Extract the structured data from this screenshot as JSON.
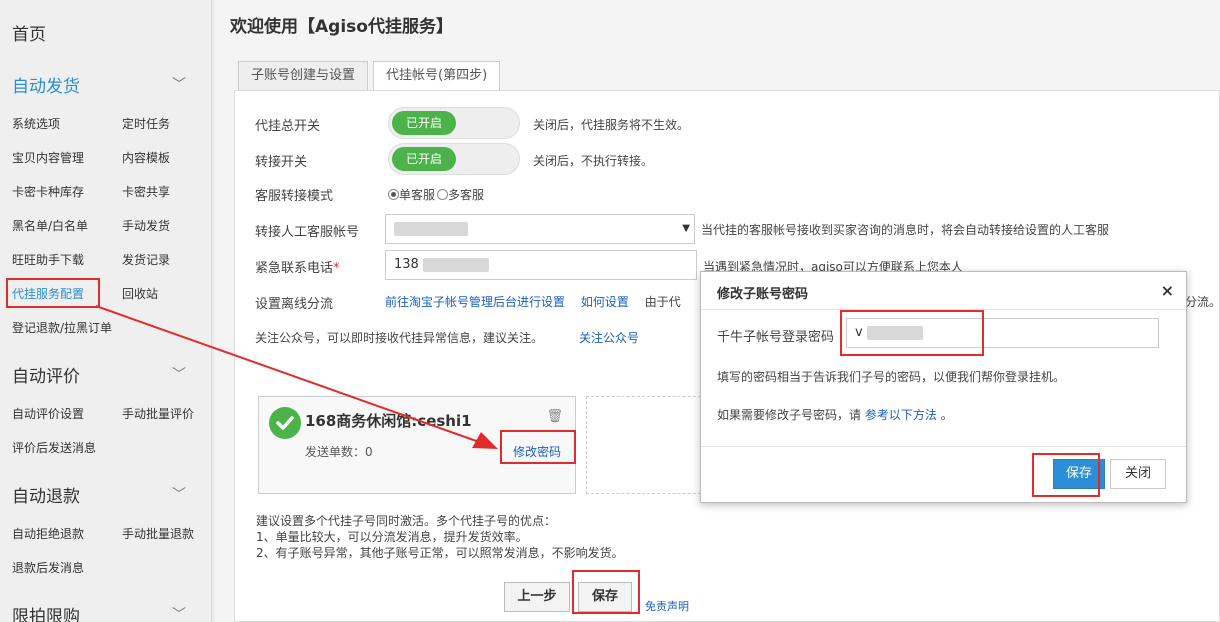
{
  "sidebar": {
    "home": "首页",
    "sections": [
      {
        "title": "自动发货",
        "items": [
          "系统选项",
          "定时任务",
          "宝贝内容管理",
          "内容模板",
          "卡密卡种库存",
          "卡密共享",
          "黑名单/白名单",
          "手动发货",
          "旺旺助手下载",
          "发货记录",
          "代挂服务配置",
          "回收站",
          "登记退款/拉黑订单"
        ]
      },
      {
        "title": "自动评价",
        "items": [
          "自动评价设置",
          "手动批量评价",
          "评价后发送消息"
        ]
      },
      {
        "title": "自动退款",
        "items": [
          "自动拒绝退款",
          "手动批量退款",
          "退款后发消息"
        ]
      },
      {
        "title": "限拍限购"
      }
    ]
  },
  "main": {
    "welcome": "欢迎使用【Agiso代挂服务】",
    "tabs": [
      "子账号创建与设置",
      "代挂帐号(第四步)"
    ],
    "master_switch": {
      "label": "代挂总开关",
      "state": "已开启",
      "hint": "关闭后，代挂服务将不生效。"
    },
    "transfer_switch": {
      "label": "转接开关",
      "state": "已开启",
      "hint": "关闭后，不执行转接。"
    },
    "cs_mode": {
      "label": "客服转接模式",
      "options": [
        "单客服",
        "多客服"
      ],
      "selected": "单客服"
    },
    "cs_account": {
      "label": "转接人工客服帐号",
      "hint": "当代挂的客服帐号接收到买家咨询的消息时，将会自动转接给设置的人工客服"
    },
    "phone": {
      "label": "紧急联系电话",
      "required_mark": "*",
      "value": "138",
      "hint": "当遇到紧急情况时，agiso可以方便联系上您本人"
    },
    "offline": {
      "label": "设置离线分流",
      "link1": "前往淘宝子帐号管理后台进行设置",
      "link2": "如何设置",
      "hint_prefix": "由于代",
      "hint_suffix": "分流。"
    },
    "follow": {
      "text": "关注公众号，可以即时接收代挂异常信息，建议关注。",
      "link": "关注公众号"
    },
    "account_card": {
      "name": "168商务休闲馆:ceshi1",
      "count_label": "发送单数：0",
      "change_pwd": "修改密码"
    },
    "advice": [
      "建议设置多个代挂子号同时激活。多个代挂子号的优点：",
      "1、单量比较大，可以分流发消息，提升发货效率。",
      "2、有子账号异常，其他子账号正常，可以照常发消息，不影响发货。"
    ],
    "prev_button": "上一步",
    "save_button": "保存",
    "disclaimer": "免责声明"
  },
  "modal": {
    "title": "修改子账号密码",
    "close": "×",
    "field_label": "千牛子帐号登录密码",
    "field_value": "v",
    "info1": "填写的密码相当于告诉我们子号的密码，以便我们帮你登录挂机。",
    "info2_prefix": "如果需要修改子号密码，请",
    "info2_link": "参考以下方法",
    "info2_suffix": "。",
    "save": "保存",
    "close_button": "关闭"
  },
  "colors": {
    "accent": "#2a8fd6",
    "switch_on": "#4cb34a",
    "highlight": "#e22c2c",
    "link": "#1a5fc0"
  }
}
